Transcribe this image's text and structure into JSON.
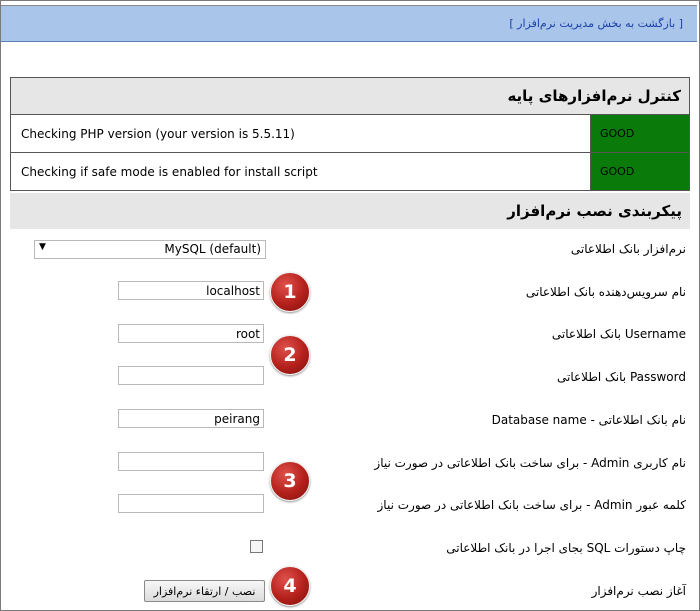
{
  "header": {
    "back_link": "[ بازگشت به بخش مدیریت نرم‌افزار ]"
  },
  "basic_check": {
    "title": "کنترل نرم‌افزارهای پایه",
    "rows": [
      {
        "label": "Checking PHP version (your version is 5.5.11)",
        "status": "GOOD"
      },
      {
        "label": "Checking if safe mode is enabled for install script",
        "status": "GOOD"
      }
    ],
    "status_color": "#0a7a0a"
  },
  "install": {
    "title": "پیکربندی نصب نرم‌افزار",
    "db_software": {
      "label": "نرم‌افزار بانک اطلاعاتی",
      "selected": "MySQL (default)"
    },
    "db_host": {
      "label": "نام سرویس‌دهنده بانک اطلاعاتی",
      "value": "localhost"
    },
    "db_username": {
      "label": "Username بانک اطلاعاتی",
      "value": "root"
    },
    "db_password": {
      "label": "Password بانک اطلاعاتی",
      "value": ""
    },
    "db_name": {
      "label": "نام بانک اطلاعاتی - Database name",
      "value": "peirang"
    },
    "admin_username": {
      "label": "نام کاربری Admin - برای ساخت بانک اطلاعاتی در صورت نیاز",
      "value": ""
    },
    "admin_password": {
      "label": "کلمه عبور Admin - برای ساخت بانک اطلاعاتی در صورت نیاز",
      "value": ""
    },
    "print_sql": {
      "label": "چاپ دستورات SQL بجای اجرا در بانک اطلاعاتی",
      "checked": false
    },
    "start": {
      "label": "آغاز نصب نرم‌افزار",
      "button": "نصب / ارتقاء نرم‌افزار"
    }
  },
  "steps": [
    "1",
    "2",
    "3",
    "4"
  ],
  "colors": {
    "header_bg": "#a9c5ea",
    "step_badge": "#b3201b",
    "section_bg": "#e6e6e6"
  }
}
